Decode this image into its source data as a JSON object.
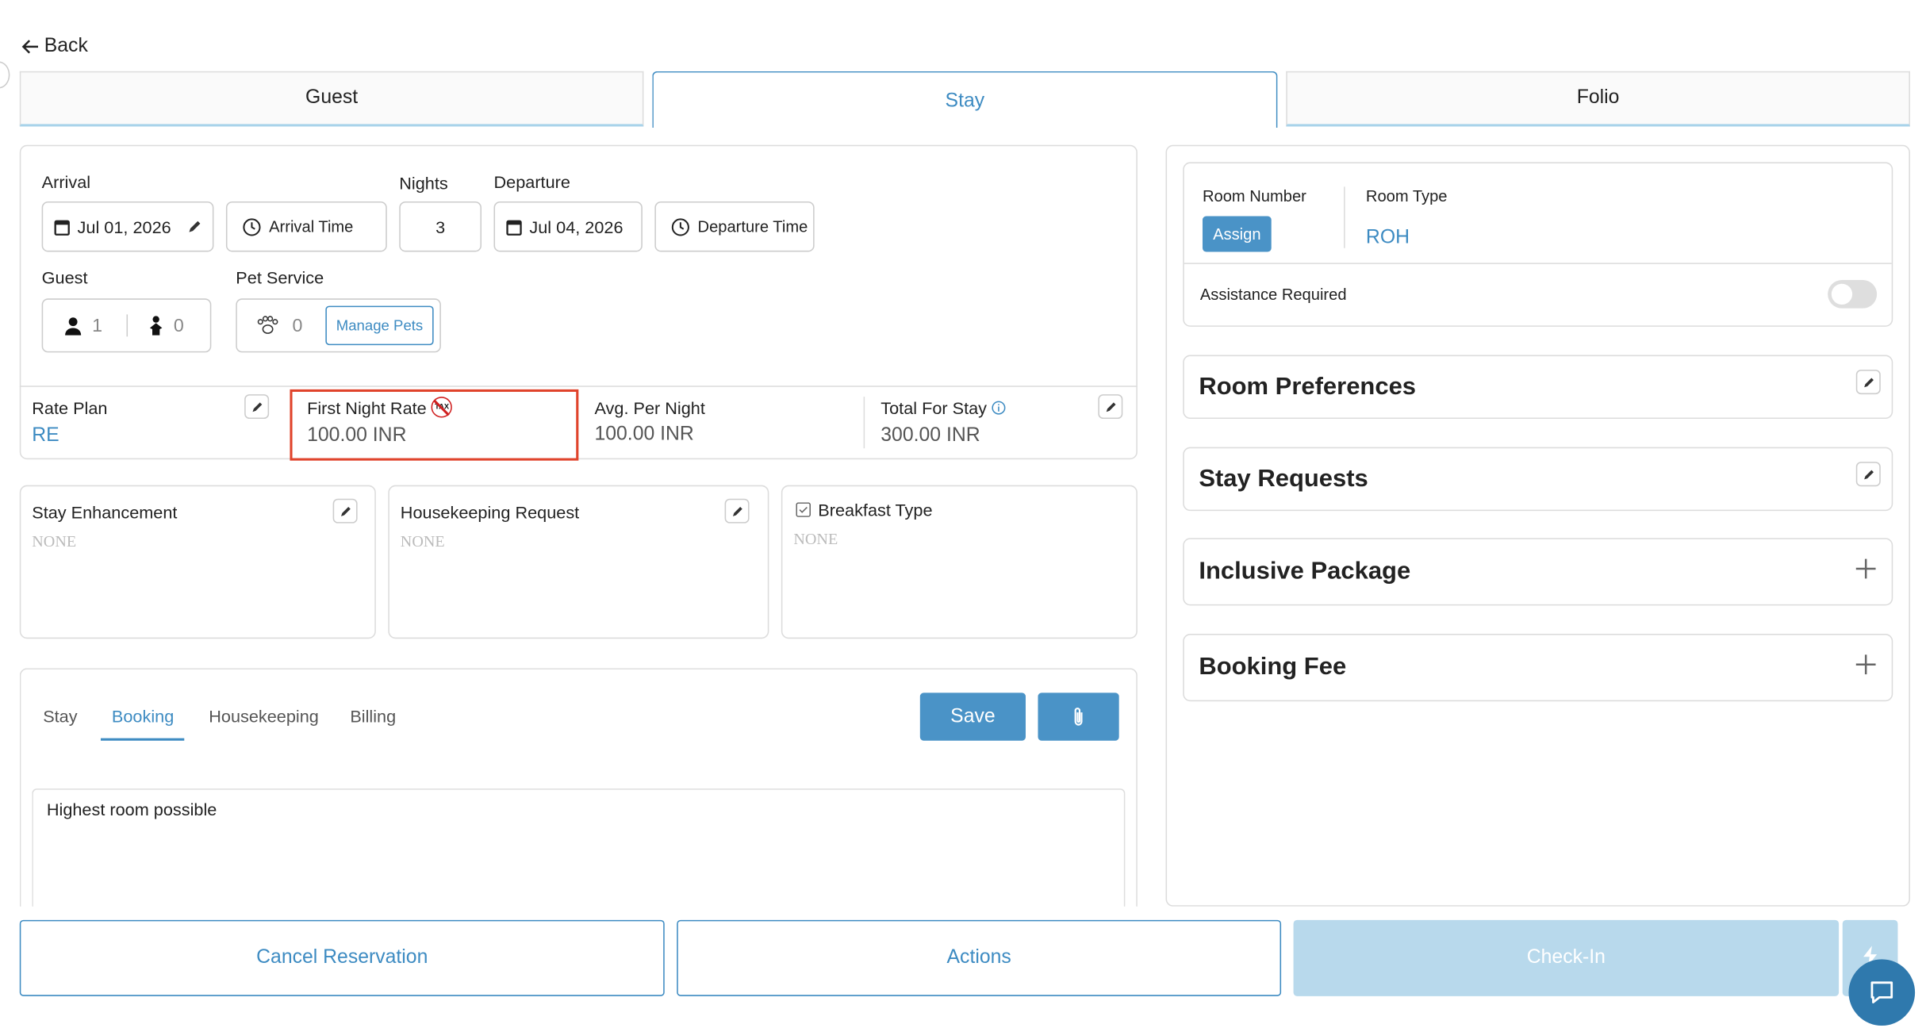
{
  "nav": {
    "back_label": "Back"
  },
  "tabs": [
    {
      "label": "Guest"
    },
    {
      "label": "Stay"
    },
    {
      "label": "Folio"
    }
  ],
  "dates": {
    "arrival_label": "Arrival",
    "arrival_value": "Jul 01, 2026",
    "arrival_time_label": "Arrival Time",
    "nights_label": "Nights",
    "nights_value": "3",
    "departure_label": "Departure",
    "departure_value": "Jul 04, 2026",
    "departure_time_label": "Departure Time"
  },
  "guest": {
    "label": "Guest",
    "adults": "1",
    "children": "0"
  },
  "pets": {
    "label": "Pet Service",
    "count": "0",
    "manage_label": "Manage Pets"
  },
  "rates": {
    "rate_plan_label": "Rate Plan",
    "rate_plan_value": "RE",
    "first_night_label": "First Night Rate",
    "tax_badge": "TAX",
    "first_night_value": "100.00 INR",
    "avg_label": "Avg. Per Night",
    "avg_value": "100.00 INR",
    "total_label": "Total For Stay",
    "total_value": "300.00 INR"
  },
  "extras": {
    "stay_enhancement_label": "Stay Enhancement",
    "stay_enhancement_value": "NONE",
    "housekeeping_label": "Housekeeping Request",
    "housekeeping_value": "NONE",
    "breakfast_label": "Breakfast Type",
    "breakfast_value": "NONE"
  },
  "notes": {
    "tabs": [
      "Stay",
      "Booking",
      "Housekeeping",
      "Billing"
    ],
    "active_tab": "Booking",
    "save_label": "Save",
    "text": "Highest room possible"
  },
  "room": {
    "room_number_label": "Room Number",
    "assign_label": "Assign",
    "room_type_label": "Room Type",
    "room_type_value": "ROH",
    "assistance_label": "Assistance Required"
  },
  "sections": {
    "room_preferences": "Room Preferences",
    "stay_requests": "Stay Requests",
    "inclusive_package": "Inclusive Package",
    "booking_fee": "Booking Fee"
  },
  "footer": {
    "cancel_label": "Cancel Reservation",
    "actions_label": "Actions",
    "checkin_label": "Check-In"
  },
  "colors": {
    "accent": "#3d8bc2",
    "checkin_disabled": "#b8d9ec",
    "highlight": "#e0432b"
  }
}
